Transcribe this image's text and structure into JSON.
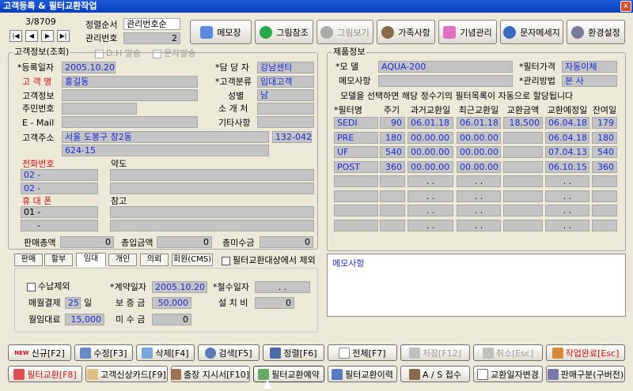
{
  "window": {
    "title": "고객등록 & 필터교환작업",
    "close": "x"
  },
  "nav": {
    "counter": "3/8709",
    "sort_label": "정렬순서",
    "sort_value": "관리번호순",
    "id_label": "관리번호",
    "id_value": "2",
    "dh_label": "D.H 발송",
    "sms_label": "문자발송"
  },
  "toolbar": [
    {
      "label": "메모장"
    },
    {
      "label": "그림참조"
    },
    {
      "label": "그림보기"
    },
    {
      "label": "가족사항"
    },
    {
      "label": "기념관리"
    },
    {
      "label": "문자메세지"
    },
    {
      "label": "환경설정"
    }
  ],
  "customer": {
    "group_title": "고객정보(조회)",
    "reg_date_label": "*등록일자",
    "reg_date": "2005.10.20",
    "manager_label": "*담 당 자",
    "manager": "강남센타",
    "name_label": "고 객 명",
    "name": "홍길동",
    "category_label": "*고객분류",
    "category": "임대고객",
    "info_label": "고객정보",
    "gender_label": "성별",
    "gender": "남",
    "ssn_label": "주민번호",
    "referrer_label": "소 개 처",
    "email_label": "E - Mail",
    "other_label": "기타사항",
    "address_label": "고객주소",
    "address1": "서울 도봉구 창2동",
    "zip": "132-042",
    "address2": "624-15",
    "phone_label": "전화번호",
    "phone1": "02 -",
    "phone2": "02 -",
    "mobile_label": "휴 대 폰",
    "mobile1": "01 -",
    "mobile2": "-",
    "map_label": "약도",
    "note_label": "참고",
    "sales_total_label": "판매총액",
    "sales_total": "0",
    "paid_total_label": "총입금액",
    "paid_total": "0",
    "unpaid_total_label": "총미수금",
    "unpaid_total": "0"
  },
  "tabs": [
    "판매",
    "할부",
    "임대",
    "개인",
    "의뢰",
    "회원(CMS)"
  ],
  "exclude_filter_label": "필터교환대상에서 제외",
  "contract": {
    "exclude_label": "수납제외",
    "contract_date_label": "*계약일자",
    "contract_date": "2005.10.20",
    "removal_date_label": "*철수일자",
    "removal_date": ". .",
    "monthly_label": "매월결제",
    "monthly_day": "25",
    "day_unit": "일",
    "deposit_label": "보 증 금",
    "deposit": "50,000",
    "install_label": "설 치 비",
    "install": "0",
    "rent_label": "월임대료",
    "rent": "15,000",
    "unpaid_label": "미 수 금",
    "unpaid": "0"
  },
  "product": {
    "group_title": "제품정보",
    "model_label": "*모 델",
    "model": "AQUA-200",
    "price_label": "*필터가격",
    "price": "자동이체",
    "memo_label": "메모사항",
    "method_label": "*관리방법",
    "method": "본 사",
    "hint": "모델을 선택하면 해당 정수기의 필터목록이 자동으로 할당됩니다",
    "columns": [
      "*필터명",
      "주기",
      "과거교환일",
      "최근교환일",
      "교환금액",
      "교환예정일",
      "잔여일"
    ],
    "rows": [
      [
        "SEDI",
        "90",
        "06.01.18",
        "06.01.18",
        "18,500",
        "06.04.18",
        "179"
      ],
      [
        "PRE",
        "180",
        "00.00.00",
        "00.00.00",
        "",
        "06.04.18",
        "180"
      ],
      [
        "UF",
        "540",
        "00.00.00",
        "00.00.00",
        "",
        "07.04.13",
        "540"
      ],
      [
        "POST",
        "360",
        "00.00.00",
        "00.00.00",
        "",
        "06.10.15",
        "360"
      ],
      [
        "",
        "",
        ". .",
        ". .",
        "",
        ". .",
        ""
      ],
      [
        "",
        "",
        ". .",
        ". .",
        "",
        ". .",
        ""
      ],
      [
        "",
        "",
        ". .",
        ". .",
        "",
        ". .",
        ""
      ],
      [
        "",
        "",
        ". .",
        ". .",
        "",
        ". .",
        ""
      ]
    ],
    "memo_area_label": "메모사항"
  },
  "bottom_row1": [
    {
      "label": "신규[F2]",
      "badge": "NEW"
    },
    {
      "label": "수정[F3]"
    },
    {
      "label": "삭제[F4]"
    },
    {
      "label": "검색[F5]"
    },
    {
      "label": "정렬[F6]"
    },
    {
      "label": "전체[F7]"
    },
    {
      "label": "저장[F12]"
    },
    {
      "label": "취소[Esc]"
    },
    {
      "label": "작업완료[Esc]"
    }
  ],
  "bottom_row2": [
    {
      "label": "필터교환[F8]"
    },
    {
      "label": "고객신상카드[F9]"
    },
    {
      "label": "출장 지시서[F10]"
    },
    {
      "label": "필터교환예약"
    },
    {
      "label": "필터교환이력"
    },
    {
      "label": "A / S 접수"
    },
    {
      "label": "교환일자변경"
    },
    {
      "label": "판매구분(구버전)"
    }
  ],
  "colors": {
    "title_bar": "#0a3fb8",
    "field_bg": "#c4c4c4",
    "value_text": "#1a2ad8",
    "label_red": "#d01010"
  }
}
